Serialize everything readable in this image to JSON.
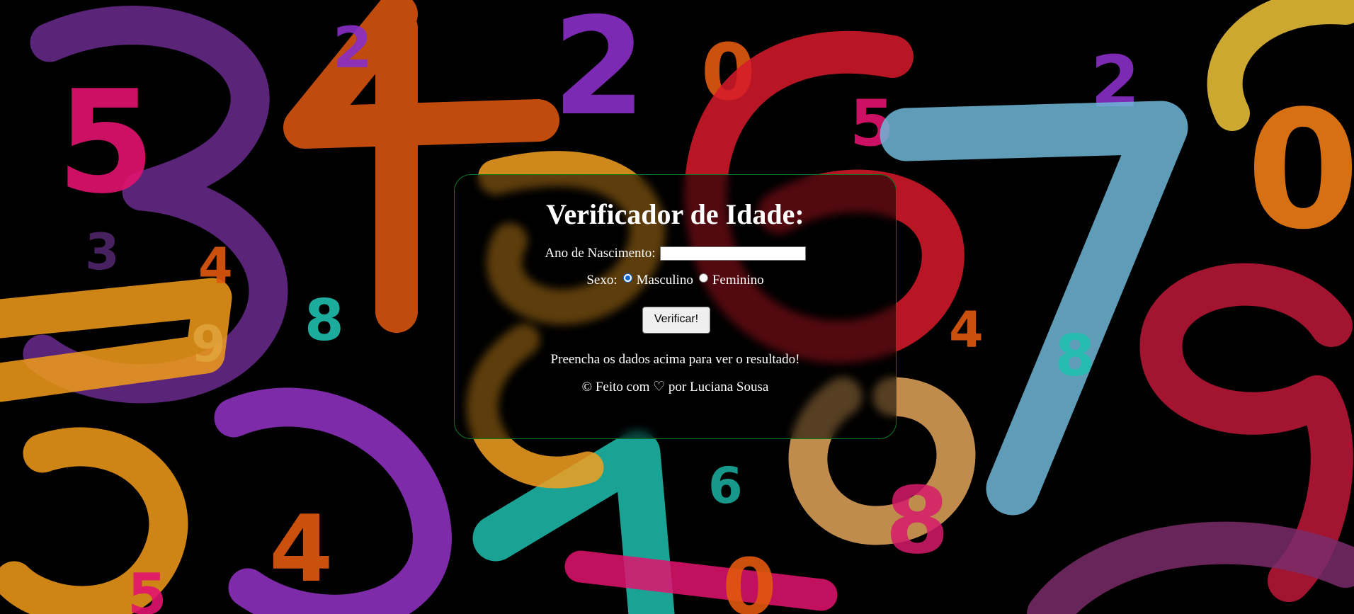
{
  "card": {
    "title": "Verificador de Idade:",
    "year_label": "Ano de Nascimento:",
    "year_value": "",
    "sex_label": "Sexo:",
    "sex_options": [
      {
        "label": "Masculino",
        "checked": true
      },
      {
        "label": "Feminino",
        "checked": false
      }
    ],
    "button_label": "Verificar!",
    "result_text": "Preencha os dados acima para ver o resultado!",
    "footer_text": "© Feito com ♡ por Luciana Sousa"
  },
  "colors": {
    "card_border": "#0a7a1e",
    "background": "#000000",
    "radio_accent": "#0b67d6"
  },
  "background": {
    "description_icon": "chalk-numbers-background"
  }
}
